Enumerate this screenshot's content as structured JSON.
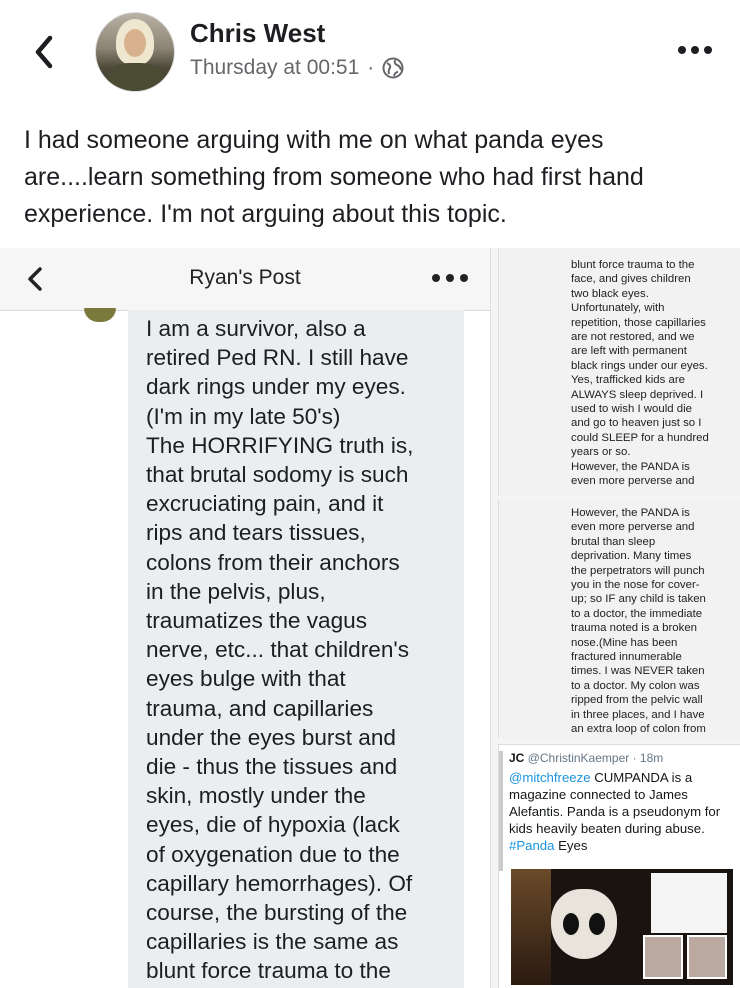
{
  "post": {
    "author": "Chris West",
    "timestamp": "Thursday at 00:51",
    "separator": "·",
    "caption": "I had someone arguing with me on what panda eyes are....learn something from someone who had first hand experience. I'm not arguing about this topic."
  },
  "icons": {
    "back": "chevron-left-icon",
    "audience": "globe-icon",
    "more": "more-dots-icon"
  },
  "screenshot_main": {
    "title": "Ryan's Post",
    "comment_text": "I am a survivor, also a\nretired Ped RN. I still have\ndark rings under my eyes.\n(I'm in my late 50's)\nThe HORRIFYING truth is,\nthat brutal sodomy is such\nexcruciating pain, and it\nrips and tears tissues,\ncolons from their anchors\nin the pelvis, plus,\ntraumatizes the vagus\nnerve, etc... that children's\neyes bulge with that\ntrauma, and capillaries\nunder the eyes burst and\ndie - thus the tissues and\nskin, mostly under the\neyes, die of hypoxia (lack\nof oxygenation due to the\ncapillary hemorrhages). Of\ncourse, the bursting of the\ncapillaries is the same as\nblunt force trauma to the"
  },
  "screenshot_strip1": {
    "text": "blunt force trauma to the\nface, and gives children\ntwo black eyes.\nUnfortunately, with\nrepetition, those capillaries\nare not restored, and we\nare left with permanent\nblack rings under our eyes.\nYes, trafficked kids are\nALWAYS sleep deprived. I\nused to wish I would die\nand go to heaven just so I\ncould SLEEP for a hundred\nyears or so.\nHowever, the PANDA is\neven more perverse and"
  },
  "screenshot_strip2": {
    "text": "However, the PANDA is\neven more perverse and\nbrutal than sleep\ndeprivation. Many times\nthe perpetrators will punch\nyou in the nose for cover-\nup; so IF any child is taken\nto a doctor, the immediate\ntrauma noted is a broken\nnose.(Mine has been\nfractured innumerable\ntimes. I was NEVER taken\nto a doctor. My colon was\nripped from the pelvic wall\nin three places, and I have\nan extra loop of colon from"
  },
  "tweet": {
    "name": "JC",
    "handle": "@ChristinKaemper",
    "time": "· 18m",
    "mention": "@mitchfreeze",
    "text_a": " CUMPANDA is a magazine connected to James Alefantis. Panda is a pseudonym for kids heavily beaten during abuse. ",
    "hashtag": "#Panda",
    "text_b": " Eyes"
  }
}
